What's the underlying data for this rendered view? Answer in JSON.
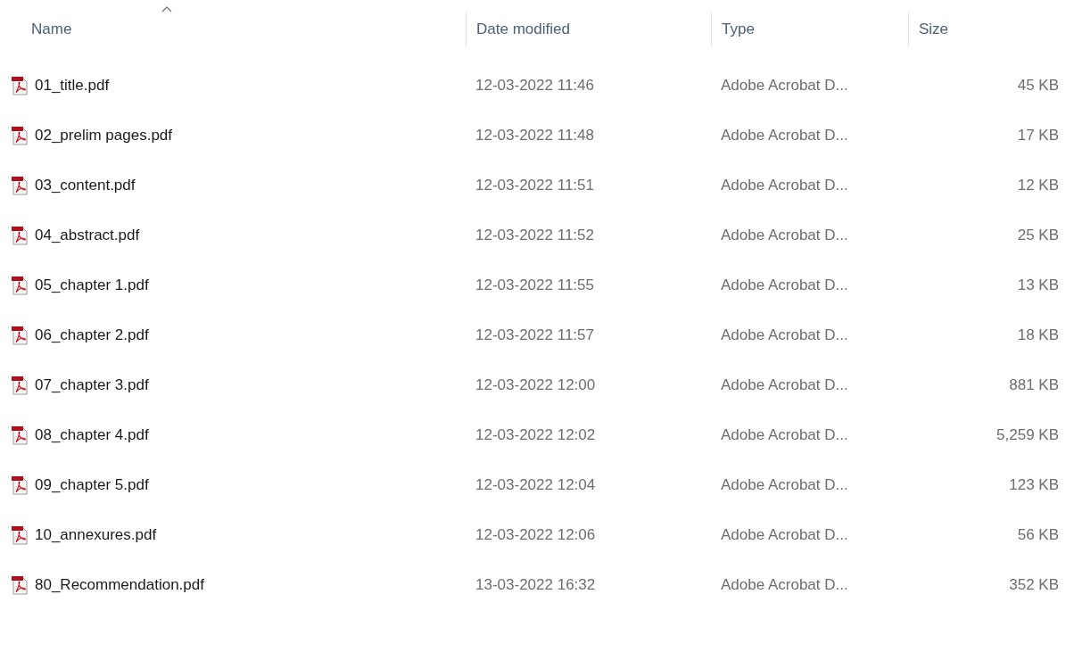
{
  "columns": [
    {
      "label": "Name",
      "sorted": true
    },
    {
      "label": "Date modified",
      "sorted": false
    },
    {
      "label": "Type",
      "sorted": false
    },
    {
      "label": "Size",
      "sorted": false
    }
  ],
  "files": [
    {
      "name": "01_title.pdf",
      "date": "12-03-2022 11:46",
      "type": "Adobe Acrobat D...",
      "size": "45 KB"
    },
    {
      "name": "02_prelim pages.pdf",
      "date": "12-03-2022 11:48",
      "type": "Adobe Acrobat D...",
      "size": "17 KB"
    },
    {
      "name": "03_content.pdf",
      "date": "12-03-2022 11:51",
      "type": "Adobe Acrobat D...",
      "size": "12 KB"
    },
    {
      "name": "04_abstract.pdf",
      "date": "12-03-2022 11:52",
      "type": "Adobe Acrobat D...",
      "size": "25 KB"
    },
    {
      "name": "05_chapter 1.pdf",
      "date": "12-03-2022 11:55",
      "type": "Adobe Acrobat D...",
      "size": "13 KB"
    },
    {
      "name": "06_chapter 2.pdf",
      "date": "12-03-2022 11:57",
      "type": "Adobe Acrobat D...",
      "size": "18 KB"
    },
    {
      "name": "07_chapter 3.pdf",
      "date": "12-03-2022 12:00",
      "type": "Adobe Acrobat D...",
      "size": "881 KB"
    },
    {
      "name": "08_chapter 4.pdf",
      "date": "12-03-2022 12:02",
      "type": "Adobe Acrobat D...",
      "size": "5,259 KB"
    },
    {
      "name": "09_chapter 5.pdf",
      "date": "12-03-2022 12:04",
      "type": "Adobe Acrobat D...",
      "size": "123 KB"
    },
    {
      "name": "10_annexures.pdf",
      "date": "12-03-2022 12:06",
      "type": "Adobe Acrobat D...",
      "size": "56 KB"
    },
    {
      "name": "80_Recommendation.pdf",
      "date": "13-03-2022 16:32",
      "type": "Adobe Acrobat D...",
      "size": "352 KB"
    }
  ]
}
